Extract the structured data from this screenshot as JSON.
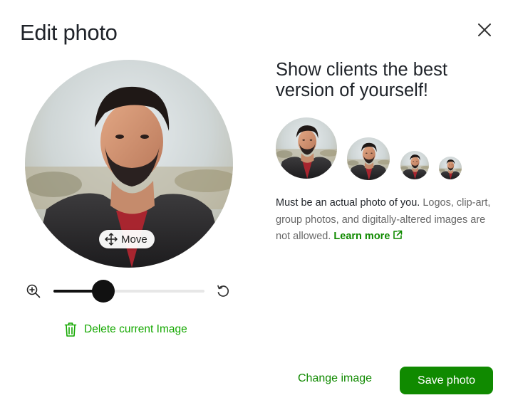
{
  "dialog": {
    "title": "Edit photo",
    "close_icon": "close-icon"
  },
  "editor": {
    "move_label": "Move",
    "move_icon": "move-arrows-icon",
    "zoom_icon": "zoom-in-icon",
    "rotate_icon": "rotate-icon",
    "zoom_level": 0.33,
    "delete_label": "Delete current Image",
    "delete_icon": "trash-icon"
  },
  "guidance": {
    "headline": "Show clients the best version of yourself!",
    "preview_sizes": [
      "large",
      "medium",
      "small",
      "extra-small"
    ],
    "requirement_strong": "Must be an actual photo of you.",
    "requirement_rest": " Logos, clip-art, group photos, and digitally-altered images are not allowed. ",
    "learn_more": "Learn more",
    "learn_more_icon": "external-link-icon"
  },
  "footer": {
    "change_label": "Change image",
    "save_label": "Save photo"
  },
  "colors": {
    "accent": "#108a00",
    "accent_light": "#14a800",
    "text": "#1f2329",
    "muted": "#676767"
  }
}
